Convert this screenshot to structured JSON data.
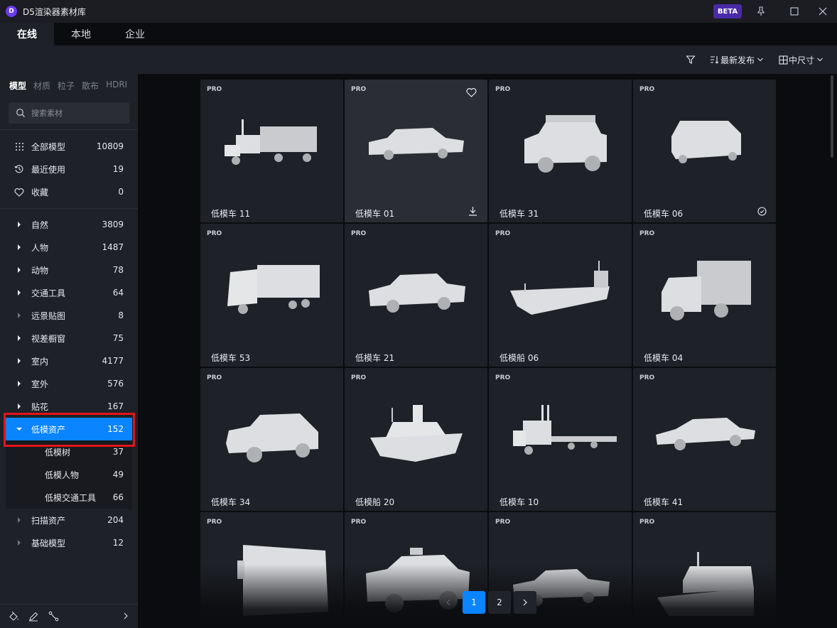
{
  "app": {
    "logo_letter": "D",
    "title": "D5渲染器素材库",
    "beta_label": "BETA"
  },
  "tabs": [
    {
      "label": "在线"
    },
    {
      "label": "本地"
    },
    {
      "label": "企业"
    }
  ],
  "toolbar": {
    "sort_label": "最新发布",
    "size_label": "中尺寸"
  },
  "sidebar": {
    "category_tabs": [
      {
        "label": "模型"
      },
      {
        "label": "材质"
      },
      {
        "label": "粒子"
      },
      {
        "label": "散布"
      },
      {
        "label": "HDRI"
      }
    ],
    "search_placeholder": "搜索素材",
    "quick": [
      {
        "label": "全部模型",
        "count": "10809",
        "icon": "grid-icon"
      },
      {
        "label": "最近使用",
        "count": "19",
        "icon": "history-icon"
      },
      {
        "label": "收藏",
        "count": "0",
        "icon": "heart-icon"
      }
    ],
    "categories": [
      {
        "label": "自然",
        "count": "3809"
      },
      {
        "label": "人物",
        "count": "1487"
      },
      {
        "label": "动物",
        "count": "78"
      },
      {
        "label": "交通工具",
        "count": "64"
      },
      {
        "label": "远景贴图",
        "count": "8"
      },
      {
        "label": "视差橱窗",
        "count": "75"
      },
      {
        "label": "室内",
        "count": "4177"
      },
      {
        "label": "室外",
        "count": "576"
      },
      {
        "label": "贴花",
        "count": "167"
      },
      {
        "label": "低模资产",
        "count": "152"
      },
      {
        "label": "扫描资产",
        "count": "204"
      },
      {
        "label": "基础模型",
        "count": "12"
      }
    ],
    "subcategories": [
      {
        "label": "低模树",
        "count": "37"
      },
      {
        "label": "低模人物",
        "count": "49"
      },
      {
        "label": "低模交通工具",
        "count": "66"
      }
    ]
  },
  "assets": [
    {
      "name": "低模车 11",
      "badge": "PRO"
    },
    {
      "name": "低模车 01",
      "badge": "PRO"
    },
    {
      "name": "低模车 31",
      "badge": "PRO"
    },
    {
      "name": "低模车 06",
      "badge": "PRO"
    },
    {
      "name": "低模车 53",
      "badge": "PRO"
    },
    {
      "name": "低模车 21",
      "badge": "PRO"
    },
    {
      "name": "低模船 06",
      "badge": "PRO"
    },
    {
      "name": "低模车 04",
      "badge": "PRO"
    },
    {
      "name": "低模车 34",
      "badge": "PRO"
    },
    {
      "name": "低模船 20",
      "badge": "PRO"
    },
    {
      "name": "低模车 10",
      "badge": "PRO"
    },
    {
      "name": "低模车 41",
      "badge": "PRO"
    },
    {
      "name": "",
      "badge": "PRO"
    },
    {
      "name": "",
      "badge": "PRO"
    },
    {
      "name": "",
      "badge": "PRO"
    },
    {
      "name": "",
      "badge": "PRO"
    }
  ],
  "pagination": {
    "pages": [
      "1",
      "2"
    ],
    "current": "1"
  },
  "colors": {
    "accent": "#0a84ff",
    "highlight": "#e3131b",
    "beta": "#4a2aa8"
  }
}
